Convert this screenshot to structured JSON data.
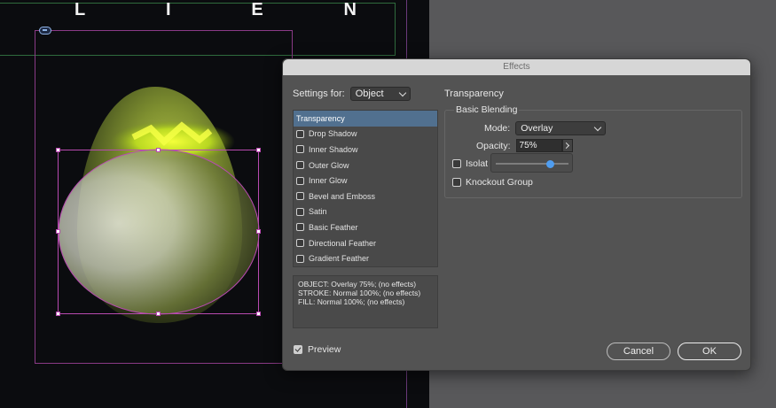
{
  "canvas": {
    "title_letters": [
      "L",
      "I",
      "E",
      "N"
    ]
  },
  "dialog": {
    "title": "Effects",
    "settings_for_label": "Settings for:",
    "settings_for_value": "Object",
    "effects": [
      {
        "label": "Transparency",
        "selected": true,
        "checkbox": false
      },
      {
        "label": "Drop Shadow",
        "selected": false,
        "checkbox": true
      },
      {
        "label": "Inner Shadow",
        "selected": false,
        "checkbox": true
      },
      {
        "label": "Outer Glow",
        "selected": false,
        "checkbox": true
      },
      {
        "label": "Inner Glow",
        "selected": false,
        "checkbox": true
      },
      {
        "label": "Bevel and Emboss",
        "selected": false,
        "checkbox": true
      },
      {
        "label": "Satin",
        "selected": false,
        "checkbox": true
      },
      {
        "label": "Basic Feather",
        "selected": false,
        "checkbox": true
      },
      {
        "label": "Directional Feather",
        "selected": false,
        "checkbox": true
      },
      {
        "label": "Gradient Feather",
        "selected": false,
        "checkbox": true
      }
    ],
    "summary": [
      "OBJECT: Overlay 75%; (no effects)",
      "STROKE: Normal 100%; (no effects)",
      "FILL: Normal 100%; (no effects)"
    ],
    "section_title": "Transparency",
    "group_title": "Basic Blending",
    "mode_label": "Mode:",
    "mode_value": "Overlay",
    "opacity_label": "Opacity:",
    "opacity_value": "75%",
    "opacity_fraction": 0.75,
    "isolate_label": "Isolat",
    "knockout_label": "Knockout Group",
    "preview_label": "Preview",
    "preview_checked": true,
    "cancel_label": "Cancel",
    "ok_label": "OK"
  },
  "colors": {
    "selection": "#51708f",
    "slider_thumb": "#4f9df0",
    "frame": "#8a3a86"
  }
}
